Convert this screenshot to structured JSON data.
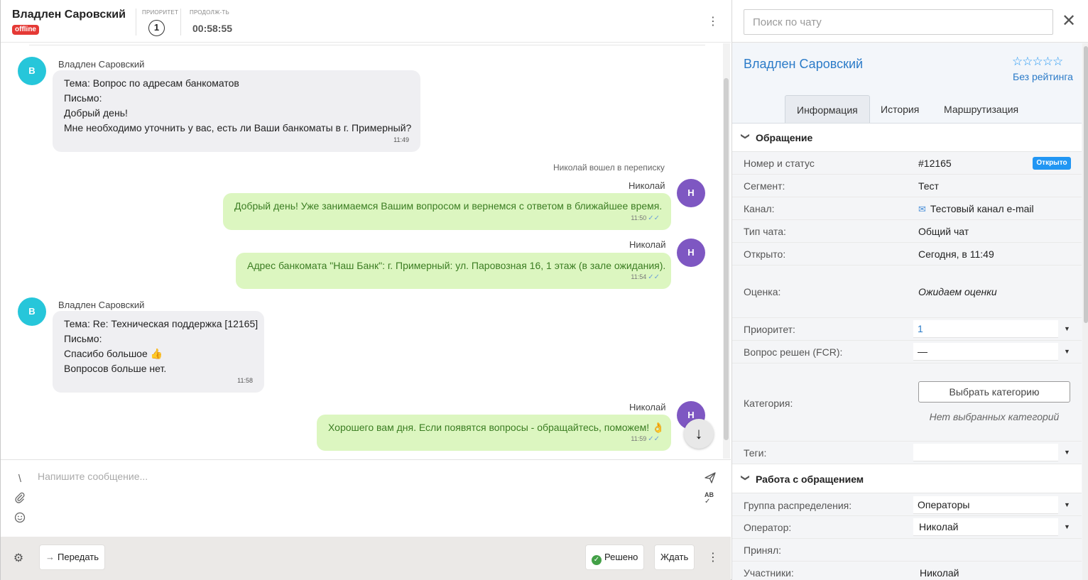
{
  "header": {
    "customer_name": "Владлен Саровский",
    "status": "offline",
    "priority_label": "ПРИОРИТЕТ",
    "priority_value": "1",
    "duration_label": "ПРОДОЛЖ-ТЬ",
    "duration_value": "00:58:55",
    "menu_icon": "kebab-icon"
  },
  "messages": [
    {
      "sender": "Владлен Саровский",
      "avatar": "В",
      "lines": [
        "Тема: Вопрос по адресам банкоматов",
        "Письмо:",
        "Добрый день!",
        "Мне необходимо уточнить у вас, есть ли Ваши банкоматы в г. Примерный?"
      ],
      "time": "11:49"
    },
    {
      "system": "Николай вошел в переписку"
    },
    {
      "sender": "Николай",
      "avatar": "Н",
      "lines": [
        "Добрый день! Уже занимаемся Вашим вопросом и вернемся с ответом в ближайшее время."
      ],
      "time": "11:50"
    },
    {
      "sender": "Николай",
      "avatar": "Н",
      "lines": [
        "Адрес банкомата \"Наш Банк\": г. Примерный: ул. Паровозная 16, 1 этаж (в зале ожидания)."
      ],
      "time": "11:54"
    },
    {
      "sender": "Владлен Саровский",
      "avatar": "В",
      "lines": [
        "Тема: Re: Техническая поддержка [12165]",
        "Письмо:",
        "Спасибо большое 👍",
        "Вопросов больше нет."
      ],
      "time": "11:58"
    },
    {
      "sender": "Николай",
      "avatar": "Н",
      "lines": [
        "Хорошего вам дня. Если появятся вопросы - обращайтесь, поможем! 👌"
      ],
      "time": "11:59"
    }
  ],
  "composer": {
    "placeholder": "Напишите сообщение...",
    "shortcut_glyph": "\\",
    "spellcheck_label": "AB"
  },
  "footer": {
    "transfer_label": "Передать",
    "resolved_label": "Решено",
    "wait_label": "Ждать"
  },
  "sidebar": {
    "search_placeholder": "Поиск по чату",
    "contact_name": "Владлен Саровский",
    "rating_stars": "☆☆☆☆☆",
    "rating_text": "Без рейтинга",
    "tabs": [
      "Информация",
      "История",
      "Маршрутизация"
    ],
    "active_tab": "Информация",
    "section_request": "Обращение",
    "fields": {
      "number_label": "Номер и статус",
      "number_value": "#12165",
      "status_badge": "Открыто",
      "segment_label": "Сегмент:",
      "segment_value": "Тест",
      "channel_label": "Канал:",
      "channel_value": "Тестовый канал e-mail",
      "chat_type_label": "Тип чата:",
      "chat_type_value": "Общий чат",
      "opened_label": "Открыто:",
      "opened_value": "Сегодня, в 11:49",
      "rating_label": "Оценка:",
      "rating_value": "Ожидаем оценки",
      "priority_label": "Приоритет:",
      "priority_value": "1",
      "fcr_label": "Вопрос решен (FCR):",
      "fcr_value": "—",
      "category_label": "Категория:",
      "category_button": "Выбрать категорию",
      "category_empty": "Нет выбранных категорий",
      "tags_label": "Теги:",
      "tags_value": ""
    },
    "section_work": "Работа с обращением",
    "work": {
      "group_label": "Группа распределения:",
      "group_value": "Операторы",
      "operator_label": "Оператор:",
      "operator_value": "Николай",
      "accepted_label": "Принял:",
      "participants_label": "Участники:",
      "participants_value": "Николай"
    }
  },
  "colors": {
    "accent": "#2196f3",
    "offline": "#e53935",
    "outgoing_bubble": "#dcf6c0",
    "incoming_bubble": "#efeff2",
    "customer_avatar": "#26c6da",
    "operator_avatar": "#7e57c2",
    "resolved_check": "#43a047"
  }
}
